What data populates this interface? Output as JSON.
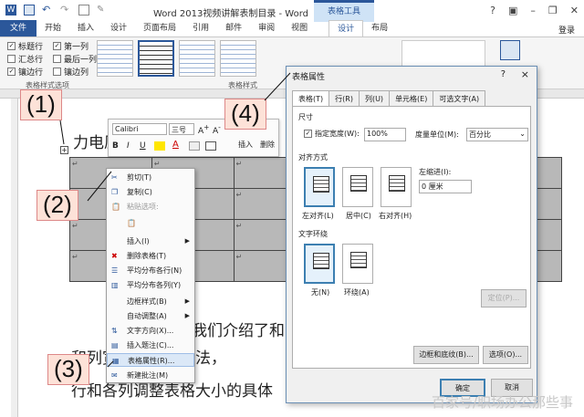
{
  "window": {
    "title": "Word 2013视频讲解表制目录 - Word",
    "context_tab": "表格工具",
    "login": "登录"
  },
  "ribbon": {
    "file_tab": "文件",
    "tabs": [
      "开始",
      "插入",
      "设计",
      "页面布局",
      "引用",
      "邮件",
      "审阅",
      "视图",
      "设计",
      "布局"
    ],
    "active_tab_index": 8,
    "options": [
      {
        "label": "标题行",
        "checked": true
      },
      {
        "label": "第一列",
        "checked": true
      },
      {
        "label": "汇总行",
        "checked": false
      },
      {
        "label": "最后一列",
        "checked": false
      },
      {
        "label": "镶边行",
        "checked": true
      },
      {
        "label": "镶边列",
        "checked": false
      }
    ],
    "group_options": "表格样式选项",
    "group_styles": "表格样式"
  },
  "doc": {
    "line1": "力电原",
    "para1": "我们介绍了和",
    "para2": "和列宽度大小的方法，",
    "para3": "行和各列调整表格大小的具体",
    "cell_mark": "↵"
  },
  "minibar": {
    "font": "Calibri",
    "size": "三号",
    "insert": "插入",
    "delete": "删除"
  },
  "context_menu": [
    {
      "label": "剪切(T)",
      "icon": "cut-icon",
      "disabled": false
    },
    {
      "label": "复制(C)",
      "icon": "copy-icon",
      "disabled": false
    },
    {
      "label": "粘贴选项:",
      "icon": "paste-icon",
      "disabled": true
    },
    {
      "label": "",
      "icon": "paste-keep-icon",
      "disabled": true
    },
    {
      "label": "插入(I)",
      "icon": "",
      "submenu": true
    },
    {
      "label": "删除表格(T)",
      "icon": "delete-table-icon"
    },
    {
      "label": "平均分布各行(N)",
      "icon": "distribute-rows-icon"
    },
    {
      "label": "平均分布各列(Y)",
      "icon": "distribute-cols-icon"
    },
    {
      "label": "边框样式(B)",
      "icon": "",
      "submenu": true
    },
    {
      "label": "自动调整(A)",
      "icon": "",
      "submenu": true
    },
    {
      "label": "文字方向(X)...",
      "icon": "text-direction-icon"
    },
    {
      "label": "插入题注(C)...",
      "icon": "caption-icon"
    },
    {
      "label": "表格属性(R)...",
      "icon": "table-properties-icon",
      "highlight": true
    },
    {
      "label": "新建批注(M)",
      "icon": "comment-icon"
    }
  ],
  "dialog": {
    "title": "表格属性",
    "help": "?",
    "close": "×",
    "tabs": [
      "表格(T)",
      "行(R)",
      "列(U)",
      "单元格(E)",
      "可选文字(A)"
    ],
    "size_label": "尺寸",
    "pref_width_label": "指定宽度(W):",
    "pref_width_value": "100%",
    "unit_label": "度量单位(M):",
    "unit_value": "百分比",
    "align_label": "对齐方式",
    "indent_label": "左缩进(I):",
    "indent_value": "0 厘米",
    "align_options": [
      "左对齐(L)",
      "居中(C)",
      "右对齐(H)"
    ],
    "wrap_label": "文字环绕",
    "wrap_options": [
      "无(N)",
      "环绕(A)"
    ],
    "position_btn": "定位(P)...",
    "borders_btn": "边框和底纹(B)...",
    "options_btn": "选项(O)...",
    "ok": "确定",
    "cancel": "取消"
  },
  "callouts": [
    "(1)",
    "(2)",
    "(3)",
    "(4)"
  ],
  "watermark": "百家号/职场办公那些事"
}
